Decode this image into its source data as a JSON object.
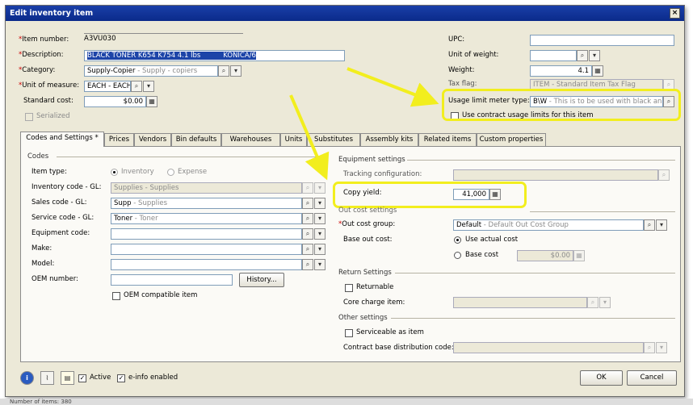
{
  "window": {
    "title": "Edit inventory item",
    "close": "×"
  },
  "left_fields": {
    "item_number": {
      "label": "Item number:",
      "value": "A3VU030"
    },
    "description": {
      "label": "Description:",
      "value": "BLACK TONER  K654 K754 4.1 lbs",
      "value2": "KONICA/6"
    },
    "category": {
      "label": "Category:",
      "value": "Supply-Copier",
      "hint": " - Supply - copiers"
    },
    "unit_of_measure": {
      "label": "Unit of measure:",
      "value": "EACH - EACH"
    },
    "standard_cost": {
      "label": "Standard cost:",
      "value": "$0.00"
    },
    "serialized": {
      "label": "Serialized"
    }
  },
  "right_fields": {
    "upc": {
      "label": "UPC:",
      "value": ""
    },
    "unit_of_weight": {
      "label": "Unit of weight:",
      "value": ""
    },
    "weight": {
      "label": "Weight:",
      "value": "4.1"
    },
    "tax_flag": {
      "label": "Tax flag:",
      "value": "ITEM - Standard Item Tax Flag"
    },
    "usage_limit": {
      "label": "Usage limit meter type:",
      "value": "B\\W",
      "hint": " - This is to be used with black and wh"
    },
    "use_contract": {
      "label": "Use contract usage limits for this item"
    }
  },
  "tabs": [
    "Codes and Settings *",
    "Prices",
    "Vendors",
    "Bin defaults",
    "Warehouses",
    "Units",
    "Substitutes",
    "Assembly kits",
    "Related items",
    "Custom properties"
  ],
  "codes": {
    "section": "Codes",
    "item_type_label": "Item type:",
    "item_type_inventory": "Inventory",
    "item_type_expense": "Expense",
    "inventory_code_label": "Inventory code - GL:",
    "inventory_code_value": "Supplies",
    "inventory_code_hint": " - Supplies",
    "sales_code_label": "Sales code - GL:",
    "sales_code_value": "Supp",
    "sales_code_hint": " - Supplies",
    "service_code_label": "Service code - GL:",
    "service_code_value": "Toner",
    "service_code_hint": " - Toner",
    "equipment_code_label": "Equipment code:",
    "make_label": "Make:",
    "model_label": "Model:",
    "oem_label": "OEM number:",
    "history_button": "History...",
    "oem_compatible": "OEM compatible item"
  },
  "equipment": {
    "section": "Equipment settings",
    "tracking_label": "Tracking configuration:",
    "copy_yield_label": "Copy yield:",
    "copy_yield_value": "41,000"
  },
  "out_cost": {
    "section": "Out cost settings",
    "group_label": "Out cost group:",
    "group_value": "Default",
    "group_hint": " - Default Out Cost Group",
    "base_label": "Base out cost:",
    "use_actual": "Use actual cost",
    "base_cost": "Base cost",
    "base_cost_value": "$0.00"
  },
  "return": {
    "section": "Return Settings",
    "returnable": "Returnable",
    "core_label": "Core charge item:"
  },
  "other": {
    "section": "Other settings",
    "serviceable": "Serviceable as item",
    "contract_label": "Contract base distribution code:"
  },
  "footer": {
    "active": "Active",
    "einfo": "e-info enabled",
    "ok": "OK",
    "cancel": "Cancel"
  },
  "status": "Number of items: 380",
  "colors": {
    "highlight": "#f2ee1e",
    "title_bar": "#0a2a8a",
    "required": "#cc0000"
  }
}
